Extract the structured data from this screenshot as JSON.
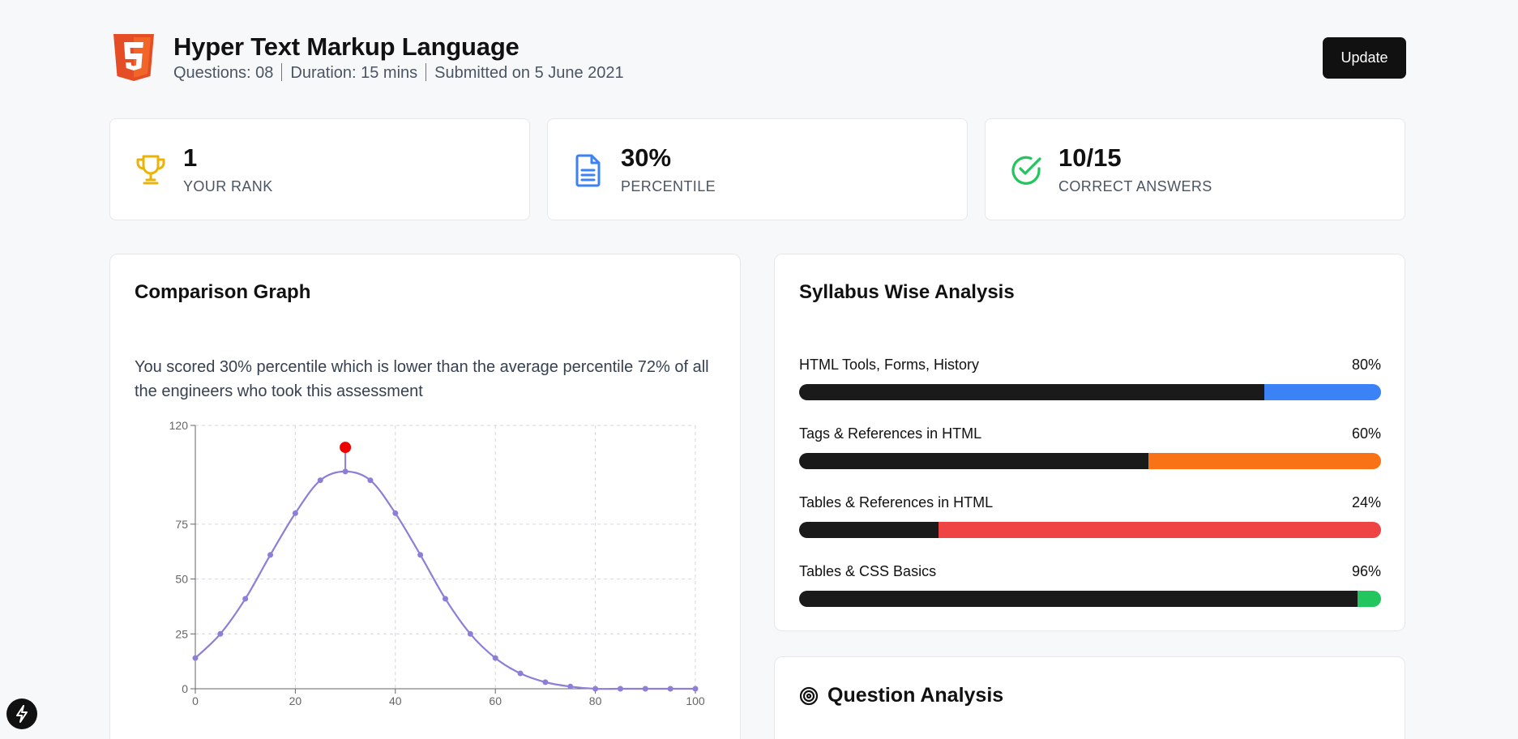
{
  "header": {
    "title": "Hyper Text Markup Language",
    "questions": "Questions: 08",
    "duration": "Duration: 15 mins",
    "submitted": "Submitted on 5 June 2021",
    "update_label": "Update",
    "logo_label": "5"
  },
  "stats": [
    {
      "value": "1",
      "label": "YOUR RANK",
      "icon": "trophy-icon",
      "color": "#eab308"
    },
    {
      "value": "30%",
      "label": "PERCENTILE",
      "icon": "document-icon",
      "color": "#3b82f6"
    },
    {
      "value": "10/15",
      "label": "CORRECT ANSWERS",
      "icon": "check-circle-icon",
      "color": "#22c55e"
    }
  ],
  "comparison": {
    "title": "Comparison Graph",
    "description": "You scored 30% percentile which is lower than the average percentile 72% of all the engineers who took this assessment"
  },
  "chart_data": {
    "type": "line",
    "x": [
      0,
      5,
      10,
      15,
      20,
      25,
      30,
      35,
      40,
      45,
      50,
      55,
      60,
      65,
      70,
      75,
      80,
      85,
      90,
      95,
      100
    ],
    "series": [
      {
        "values": [
          14,
          25,
          41,
          61,
          80,
          95,
          99,
          95,
          80,
          61,
          41,
          25,
          14,
          7,
          3,
          1,
          0,
          0,
          0,
          0,
          0
        ],
        "color": "#8b7fd8"
      }
    ],
    "highlight": {
      "x": 30,
      "y": 110,
      "color": "#ef0000"
    },
    "x_ticks": [
      0,
      20,
      40,
      60,
      80,
      100
    ],
    "y_ticks": [
      0,
      25,
      50,
      75,
      120
    ],
    "xlim": [
      0,
      100
    ],
    "ylim": [
      0,
      120
    ],
    "grid": true
  },
  "syllabus": {
    "title": "Syllabus Wise Analysis",
    "items": [
      {
        "name": "HTML Tools, Forms, History",
        "percent": 80,
        "label": "80%",
        "color": "#3b82f6"
      },
      {
        "name": "Tags & References in HTML",
        "percent": 60,
        "label": "60%",
        "color": "#f97316"
      },
      {
        "name": "Tables & References in HTML",
        "percent": 24,
        "label": "24%",
        "color": "#ef4444"
      },
      {
        "name": "Tables & CSS Basics",
        "percent": 96,
        "label": "96%",
        "color": "#22c55e"
      }
    ]
  },
  "question_analysis": {
    "title": "Question Analysis"
  }
}
